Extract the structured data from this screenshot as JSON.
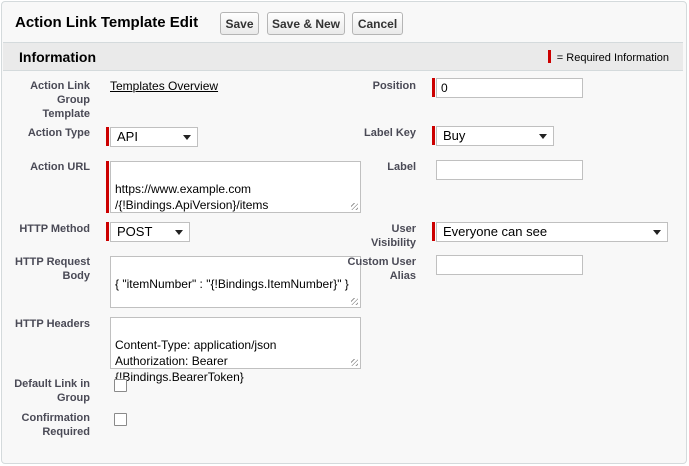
{
  "page": {
    "title": "Action Link Template Edit"
  },
  "toolbar": {
    "save_label": "Save",
    "save_new_label": "Save & New",
    "cancel_label": "Cancel"
  },
  "section": {
    "title": "Information",
    "required_legend": "= Required Information"
  },
  "fields": {
    "group_template": {
      "label": "Action Link Group Template",
      "value": "Templates Overview"
    },
    "position": {
      "label": "Position",
      "value": "0"
    },
    "action_type": {
      "label": "Action Type",
      "value": "API"
    },
    "label_key": {
      "label": "Label Key",
      "value": "Buy"
    },
    "action_url": {
      "label": "Action URL",
      "value": "https://www.example.com\n/{!Bindings.ApiVersion}/items"
    },
    "label": {
      "label": "Label",
      "value": ""
    },
    "http_method": {
      "label": "HTTP Method",
      "value": "POST"
    },
    "user_visibility": {
      "label": "User Visibility",
      "value": "Everyone can see"
    },
    "http_request_body": {
      "label": "HTTP Request Body",
      "value": "{ \"itemNumber\" : \"{!Bindings.ItemNumber}\" }"
    },
    "custom_user_alias": {
      "label": "Custom User Alias",
      "value": ""
    },
    "http_headers": {
      "label": "HTTP Headers",
      "value": "Content-Type: application/json\nAuthorization: Bearer\n{!Bindings.BearerToken}"
    },
    "default_link": {
      "label": "Default Link in Group",
      "checked": false
    },
    "confirmation_required": {
      "label": "Confirmation Required",
      "checked": false
    }
  },
  "colors": {
    "required": "#cc0000",
    "section_bg": "#eaeaea",
    "page_bg": "#f8f8f8"
  }
}
